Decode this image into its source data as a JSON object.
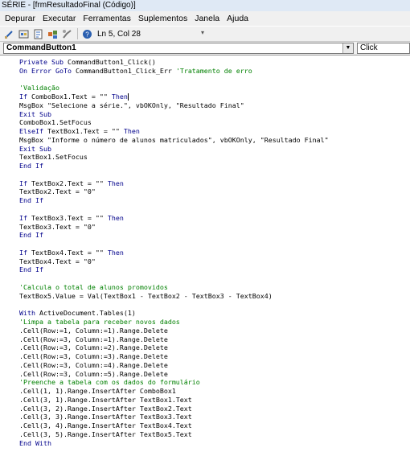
{
  "window": {
    "title": "SÉRIE - [frmResultadoFinal (Código)]"
  },
  "menu": [
    "Depurar",
    "Executar",
    "Ferramentas",
    "Suplementos",
    "Janela",
    "Ajuda"
  ],
  "toolbar": {
    "icons": [
      "design-mode-icon",
      "project-explorer-icon",
      "properties-icon",
      "object-browser-icon",
      "toolbox-icon",
      "help-icon"
    ],
    "position": "Ln 5, Col 28"
  },
  "dropdowns": {
    "object": "CommandButton1",
    "procedure": "Click"
  },
  "colors": {
    "keyword": "#00008b",
    "comment": "#008000",
    "text": "#000000"
  },
  "code": [
    [
      {
        "t": "Private Sub ",
        "k": "kw"
      },
      {
        "t": "CommandButton1_Click()"
      }
    ],
    [
      {
        "t": "On Error GoTo ",
        "k": "kw"
      },
      {
        "t": "CommandButton1_Click_Err "
      },
      {
        "t": "'Tratamento de erro",
        "k": "cm"
      }
    ],
    [],
    [
      {
        "t": "'Validação",
        "k": "cm"
      }
    ],
    [
      {
        "t": "If ",
        "k": "kw"
      },
      {
        "t": "ComboBox1.Text = \"\" "
      },
      {
        "t": "Then",
        "k": "kw"
      }
    ],
    [
      {
        "t": "MsgBox \"Selecione a série.\", vbOKOnly, \"Resultado Final\""
      }
    ],
    [
      {
        "t": "Exit Sub",
        "k": "kw"
      }
    ],
    [
      {
        "t": "ComboBox1.SetFocus"
      }
    ],
    [
      {
        "t": "ElseIf ",
        "k": "kw"
      },
      {
        "t": "TextBox1.Text = \"\" "
      },
      {
        "t": "Then",
        "k": "kw"
      }
    ],
    [
      {
        "t": "MsgBox \"Informe o número de alunos matriculados\", vbOKOnly, \"Resultado Final\""
      }
    ],
    [
      {
        "t": "Exit Sub",
        "k": "kw"
      }
    ],
    [
      {
        "t": "TextBox1.SetFocus"
      }
    ],
    [
      {
        "t": "End If",
        "k": "kw"
      }
    ],
    [],
    [
      {
        "t": "If ",
        "k": "kw"
      },
      {
        "t": "TextBox2.Text = \"\" "
      },
      {
        "t": "Then",
        "k": "kw"
      }
    ],
    [
      {
        "t": "TextBox2.Text = \"0\""
      }
    ],
    [
      {
        "t": "End If",
        "k": "kw"
      }
    ],
    [],
    [
      {
        "t": "If ",
        "k": "kw"
      },
      {
        "t": "TextBox3.Text = \"\" "
      },
      {
        "t": "Then",
        "k": "kw"
      }
    ],
    [
      {
        "t": "TextBox3.Text = \"0\""
      }
    ],
    [
      {
        "t": "End If",
        "k": "kw"
      }
    ],
    [],
    [
      {
        "t": "If ",
        "k": "kw"
      },
      {
        "t": "TextBox4.Text = \"\" "
      },
      {
        "t": "Then",
        "k": "kw"
      }
    ],
    [
      {
        "t": "TextBox4.Text = \"0\""
      }
    ],
    [
      {
        "t": "End If",
        "k": "kw"
      }
    ],
    [],
    [
      {
        "t": "'Calcula o total de alunos promovidos",
        "k": "cm"
      }
    ],
    [
      {
        "t": "TextBox5.Value = Val(TextBox1 - TextBox2 - TextBox3 - TextBox4)"
      }
    ],
    [],
    [
      {
        "t": "With ",
        "k": "kw"
      },
      {
        "t": "ActiveDocument.Tables(1)"
      }
    ],
    [
      {
        "t": "'Limpa a tabela para receber novos dados",
        "k": "cm"
      }
    ],
    [
      {
        "t": ".Cell(Row:=1, Column:=1).Range.Delete"
      }
    ],
    [
      {
        "t": ".Cell(Row:=3, Column:=1).Range.Delete"
      }
    ],
    [
      {
        "t": ".Cell(Row:=3, Column:=2).Range.Delete"
      }
    ],
    [
      {
        "t": ".Cell(Row:=3, Column:=3).Range.Delete"
      }
    ],
    [
      {
        "t": ".Cell(Row:=3, Column:=4).Range.Delete"
      }
    ],
    [
      {
        "t": ".Cell(Row:=3, Column:=5).Range.Delete"
      }
    ],
    [
      {
        "t": "'Preenche a tabela com os dados do formulário",
        "k": "cm"
      }
    ],
    [
      {
        "t": ".Cell(1, 1).Range.InsertAfter ComboBox1"
      }
    ],
    [
      {
        "t": ".Cell(3, 1).Range.InsertAfter TextBox1.Text"
      }
    ],
    [
      {
        "t": ".Cell(3, 2).Range.InsertAfter TextBox2.Text"
      }
    ],
    [
      {
        "t": ".Cell(3, 3).Range.InsertAfter TextBox3.Text"
      }
    ],
    [
      {
        "t": ".Cell(3, 4).Range.InsertAfter TextBox4.Text"
      }
    ],
    [
      {
        "t": ".Cell(3, 5).Range.InsertAfter TextBox5.Text"
      }
    ],
    [
      {
        "t": "End With",
        "k": "kw"
      }
    ]
  ]
}
